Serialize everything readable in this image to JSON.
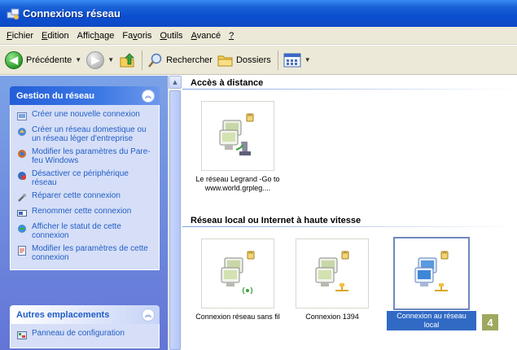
{
  "window": {
    "title": "Connexions réseau"
  },
  "menu": [
    {
      "before": "",
      "underline": "F",
      "after": "ichier"
    },
    {
      "before": "",
      "underline": "E",
      "after": "dition"
    },
    {
      "before": "Affic",
      "underline": "h",
      "after": "age"
    },
    {
      "before": "Fa",
      "underline": "v",
      "after": "oris"
    },
    {
      "before": "",
      "underline": "O",
      "after": "utils"
    },
    {
      "before": "",
      "underline": "A",
      "after": "vancé"
    },
    {
      "before": "",
      "underline": "?",
      "after": ""
    }
  ],
  "toolbar": {
    "back_label": "Précédente",
    "search_label": "Rechercher",
    "folders_label": "Dossiers"
  },
  "taskpane": {
    "network_tasks": {
      "title": "Gestion du réseau",
      "items": [
        {
          "label": "Créer une nouvelle connexion",
          "icon": "new-connection-icon"
        },
        {
          "label": "Créer un réseau domestique ou un réseau léger d'entreprise",
          "icon": "home-network-icon"
        },
        {
          "label": "Modifier les paramètres du Pare-feu Windows",
          "icon": "firewall-icon"
        },
        {
          "label": "Désactiver ce périphérique réseau",
          "icon": "disable-device-icon"
        },
        {
          "label": "Réparer cette connexion",
          "icon": "repair-icon"
        },
        {
          "label": "Renommer cette connexion",
          "icon": "rename-icon"
        },
        {
          "label": "Afficher le statut de cette connexion",
          "icon": "status-icon"
        },
        {
          "label": "Modifier les paramètres de cette connexion",
          "icon": "properties-icon"
        }
      ]
    },
    "other_places": {
      "title": "Autres emplacements",
      "items": [
        {
          "label": "Panneau de configuration",
          "icon": "control-panel-icon"
        }
      ]
    }
  },
  "content": {
    "groups": [
      {
        "title": "Accès à distance",
        "items": [
          {
            "label": "Le réseau Legrand -Go to www.world.grpleg....",
            "icon": "dialup-connection-icon",
            "selected": false
          }
        ]
      },
      {
        "title": "Réseau local ou Internet à haute vitesse",
        "items": [
          {
            "label": "Connexion réseau sans fil",
            "icon": "wireless-connection-icon",
            "selected": false
          },
          {
            "label": "Connexion 1394",
            "icon": "firewire-connection-icon",
            "selected": false
          },
          {
            "label": "Connexion au réseau local",
            "icon": "lan-connection-icon",
            "selected": true
          }
        ]
      }
    ]
  },
  "step_badge": "4",
  "colors": {
    "titlebar": "#0a4fd0",
    "taskpane_bg": "#6f8ee0",
    "link": "#215dc6",
    "selection": "#316ac5",
    "badge": "#9ea85e"
  }
}
